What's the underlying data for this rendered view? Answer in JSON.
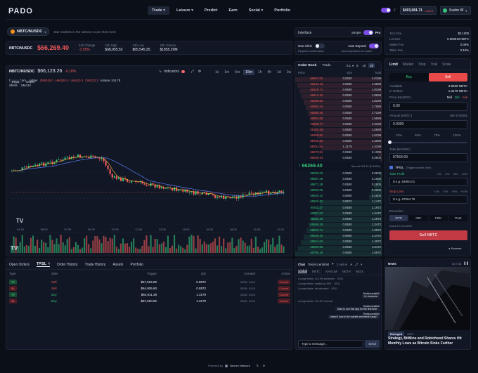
{
  "nav": {
    "logo": "PADO",
    "items": [
      {
        "label": "Trade",
        "has_dropdown": true,
        "active": true
      },
      {
        "label": "Leisure",
        "has_dropdown": true,
        "active": false
      },
      {
        "label": "Predict",
        "has_dropdown": false,
        "active": false
      },
      {
        "label": "Earn",
        "has_dropdown": false,
        "active": false
      },
      {
        "label": "Social",
        "has_dropdown": true,
        "active": false
      },
      {
        "label": "Portfolio",
        "has_dropdown": false,
        "active": false
      }
    ],
    "balance": "$493,081.71",
    "balance_change": "-1.61%",
    "user": "Sushn W"
  },
  "pair": {
    "symbol": "NBTC/NUSDC",
    "pin_hint": "Star markets in the selector to pin them here",
    "name": "NBTC/NUSDC",
    "price": "$66,269.40",
    "stats": [
      {
        "label": "24h Change",
        "value": "-3.55%",
        "color": "red"
      },
      {
        "label": "24h High",
        "value": "$68,955.53",
        "color": "white"
      },
      {
        "label": "24h Low",
        "value": "$65,545.25",
        "color": "white"
      },
      {
        "label": "24h Volume",
        "value": "$1855.29M",
        "color": "white"
      }
    ]
  },
  "chart": {
    "pair_label": "NBTC/NUSDC",
    "price": "$66,123.26",
    "change": "-0.18%",
    "indicators_label": "Indicators",
    "indicators_count": "1",
    "timeframes": [
      "1s",
      "1m",
      "5m",
      "15m",
      "1h",
      "4h",
      "1d",
      "1w",
      "1M"
    ],
    "active_timeframe": "15m",
    "legend_title": "NBTC · 15m · Lighter",
    "ohlc": [
      "O66240.0",
      "H66240.0",
      "L66110.0",
      "C66123.3"
    ],
    "volume": "Volume 104.78",
    "sma_labels": [
      "SMA5",
      "SMA20"
    ],
    "view_tabs": [
      "Price",
      "Depth"
    ],
    "x_ticks": [
      "04:30",
      "06:00",
      "07:30",
      "09:00",
      "10:30",
      "12:00",
      "13:30",
      "15:00",
      "16:30",
      "18:00",
      "19:30",
      "21:00"
    ],
    "series_visual": {
      "up_color": "#35c27a",
      "down_color": "#f05a5a",
      "sma5_color": "#e0a23a",
      "sma20_color": "#4f6fd8"
    },
    "watermark": "TV"
  },
  "interface": {
    "title": "Interface",
    "simple": "Simple",
    "pro": "Pro",
    "one_click": "One-Click",
    "one_click_desc": "Requires confirmation",
    "auto_deposit": "Auto Deposit",
    "auto_deposit_desc": "Auto-deposits from wallet"
  },
  "orderbook": {
    "tabs": [
      "Order Book",
      "Trade"
    ],
    "step": "0.1",
    "size_options": [
      "5",
      "10",
      "20"
    ],
    "active_size": "20",
    "headers": [
      "Price",
      "Size",
      "Total"
    ],
    "asks": [
      {
        "price": "66457.02",
        "size": "0.0500",
        "total": "2.0199"
      },
      {
        "price": "66443.13",
        "size": "0.0500",
        "total": "1.9699"
      },
      {
        "price": "66428.71",
        "size": "0.0500",
        "total": "1.9199"
      },
      {
        "price": "66413.10",
        "size": "0.0500",
        "total": "1.8699"
      },
      {
        "price": "66398.69",
        "size": "0.0500",
        "total": "1.8199"
      },
      {
        "price": "66383.44",
        "size": "0.0500",
        "total": "1.7699"
      },
      {
        "price": "66368.25",
        "size": "0.0500",
        "total": "1.7199"
      },
      {
        "price": "66353.59",
        "size": "0.0500",
        "total": "1.6699"
      },
      {
        "price": "66339.77",
        "size": "0.0500",
        "total": "1.6199"
      },
      {
        "price": "66324.18",
        "size": "0.0500",
        "total": "1.5699"
      },
      {
        "price": "66309.82",
        "size": "0.0500",
        "total": "1.5199"
      },
      {
        "price": "66295.30",
        "size": "0.0500",
        "total": "1.4699"
      },
      {
        "price": "66281.64",
        "size": "1.3179",
        "total": "1.4199"
      },
      {
        "price": "66270.51",
        "size": "0.0500",
        "total": "0.1000"
      },
      {
        "price": "66269.44",
        "size": "0.0500",
        "total": "0.0500"
      }
    ],
    "mid_price": "66269.40",
    "spread": "Spread 263.40 (0.398%)",
    "bids": [
      {
        "price": "66006.00",
        "size": "0.0500",
        "total": "0.0500"
      },
      {
        "price": "65987.46",
        "size": "0.0500",
        "total": "0.1000"
      },
      {
        "price": "65971.38",
        "size": "0.0500",
        "total": "0.1500"
      },
      {
        "price": "65956.05",
        "size": "0.0500",
        "total": "0.2000"
      },
      {
        "price": "65940.12",
        "size": "0.0500",
        "total": "0.2500"
      },
      {
        "price": "65926.82",
        "size": "0.8972",
        "total": "1.1472"
      },
      {
        "price": "65911.37",
        "size": "0.0500",
        "total": "1.1972"
      },
      {
        "price": "65897.02",
        "size": "0.0500",
        "total": "1.2472"
      },
      {
        "price": "65882.45",
        "size": "0.0500",
        "total": "1.2972"
      },
      {
        "price": "65868.29",
        "size": "0.0500",
        "total": "1.3472"
      },
      {
        "price": "65853.71",
        "size": "0.0500",
        "total": "1.3972"
      },
      {
        "price": "65839.10",
        "size": "0.0500",
        "total": "1.4472"
      },
      {
        "price": "65824.63",
        "size": "0.0500",
        "total": "1.4972"
      },
      {
        "price": "65809.96",
        "size": "0.0500",
        "total": "1.5472"
      },
      {
        "price": "65795.18",
        "size": "0.0500",
        "total": "1.5972"
      }
    ]
  },
  "fees": {
    "rows": [
      {
        "label": "Tick Size",
        "value": "$0.1000"
      },
      {
        "label": "Lot Size",
        "value": "0.000010 NBTC"
      },
      {
        "label": "Maker Fee",
        "value": "0.05%"
      },
      {
        "label": "Taker Fee",
        "value": "0.10%"
      }
    ]
  },
  "trade": {
    "order_types": [
      "Limit",
      "Market",
      "Stop",
      "Trail",
      "Scale"
    ],
    "active_type": "Limit",
    "buy": "Buy",
    "sell": "Sell",
    "available_label": "Available",
    "available_value": "3.9539 NBTC",
    "in_orders_label": "In Orders",
    "in_orders_value": "1.3179 NBTC",
    "price_label": "Price (NUSDC)",
    "price_shortcuts": [
      "Mid",
      "Bid",
      "Ask"
    ],
    "price_value": "0.00",
    "amount_label": "Amount (NBTC)",
    "amount_min": "Min 0.00001",
    "amount_value": "0.0000",
    "pcts": [
      "25%",
      "50%",
      "75%",
      "100%"
    ],
    "total_label": "Total (NUSDC)",
    "total_value": "87564.99",
    "tpsl_label": "TP/SL",
    "tpsl_note": "(Triggers market order)",
    "take_profit_label": "Take Profit",
    "tp_pcts": [
      "-1%",
      "-2%",
      "-5%",
      "-10%"
    ],
    "tp_placeholder": "$ e.g. 64994.01",
    "stop_loss_label": "Stop Loss",
    "sl_pcts": [
      "+1%",
      "+2%",
      "+5%",
      "+10%"
    ],
    "sl_placeholder": "$ e.g. 67594.79",
    "execution_label": "Execution",
    "executions": [
      "GTC",
      "IOC",
      "FOK",
      "Post"
    ],
    "active_execution": "GTC",
    "exec_desc": "Good-Til-Canceled",
    "submit": "Sell NBTC",
    "browser": "Browser"
  },
  "orders": {
    "tabs": [
      "Open Orders",
      "TP/SL",
      "Order History",
      "Trade History",
      "Assets",
      "Portfolio"
    ],
    "active_tab": "TP/SL",
    "tpsl_count": "4",
    "headers": [
      "Type",
      "Side",
      "Trigger",
      "Qty",
      "Created",
      "Action"
    ],
    "rows": [
      {
        "type": "TP",
        "side": "Sell",
        "trigger": "$67,554.80",
        "qty": "0.8972",
        "created": "03/26, 13:15",
        "action": "Cancel"
      },
      {
        "type": "SL",
        "side": "Sell",
        "trigger": "$64,905.60",
        "qty": "0.8972",
        "created": "03/26, 13:15",
        "action": "Cancel"
      },
      {
        "type": "TP",
        "side": "Buy",
        "trigger": "$64,911.38",
        "qty": "1.3179",
        "created": "03/26, 13:15",
        "action": "Cancel"
      },
      {
        "type": "SL",
        "side": "Buy",
        "trigger": "$67,560.82",
        "qty": "1.3179",
        "created": "03/26, 13:15",
        "action": "Cancel"
      }
    ]
  },
  "chat": {
    "title": "Chat",
    "user": "TestAccertsibi0",
    "online": "2 online",
    "channels": [
      "Global",
      "NBTC",
      "NAXUM",
      "NETH",
      "NSOL"
    ],
    "active_channel": "Global",
    "messages": [
      {
        "name": "",
        "text": "Lounge thesis: 10-15% sentiment",
        "time": "05/11",
        "me": false
      },
      {
        "name": "",
        "text": "Lounge thesis: market up 25%",
        "time": "05/11",
        "me": false
      },
      {
        "name": "",
        "text": "Lounge thesis: risk elevated",
        "time": "05/11",
        "me": false
      },
      {
        "name": "TestAccertsibi0",
        "text": "hi, everyone",
        "time": "",
        "me": true
      },
      {
        "name": "",
        "text": "Lounge thesis: 10-15% reversal",
        "time": "",
        "me": false
      },
      {
        "name": "TestAccertsibi0",
        "text": "Glad to use this app for the first time.",
        "time": "",
        "me": true
      },
      {
        "name": "TestAccertsibi0",
        "text": "doesn't how is the market sentiment today?",
        "time": "",
        "me": true
      }
    ],
    "input_placeholder": "Type a message...",
    "send": "Send"
  },
  "news": {
    "title": "News",
    "counter": "10 / 31",
    "tag": "Emerged",
    "date": "05/01",
    "headline": "Strategy, BitMine and Robinhood Shares Hit Monthly Lows as Bitcoin Sinks Further"
  },
  "footer": {
    "powered": "Powered by",
    "network": "Nexum Network"
  }
}
